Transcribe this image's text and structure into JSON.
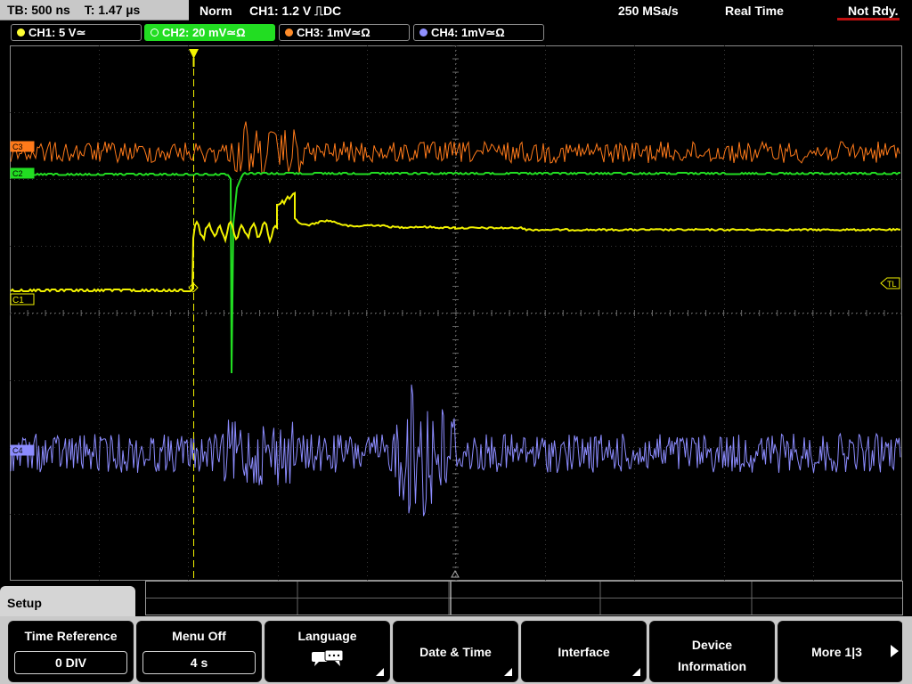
{
  "status": {
    "timebase": "TB: 500 ns",
    "trigger_time": "T: 1.47 µs",
    "mode": "Norm",
    "trigger_info": "CH1: 1.2 V ⎍DC",
    "sample_rate": "250 MSa/s",
    "acq_mode": "Real Time",
    "state": "Not Rdy."
  },
  "channels": [
    {
      "label": "CH1: 5 V≃",
      "color": "#ffff33"
    },
    {
      "label": "CH2: 20 mV≃Ω",
      "color": "#33ee33"
    },
    {
      "label": "CH3: 1mV≃Ω",
      "color": "#ff8c2a"
    },
    {
      "label": "CH4: 1mV≃Ω",
      "color": "#9090ff"
    }
  ],
  "markers": {
    "c1": "C1",
    "c2": "C2",
    "c3": "C3",
    "c4": "C4",
    "trigger_level": "TL"
  },
  "menu": {
    "title": "Setup",
    "softkeys": [
      {
        "label": "Time Reference",
        "value": "0 DIV"
      },
      {
        "label": "Menu Off",
        "value": "4 s"
      },
      {
        "label": "Language",
        "icon": "speech-bubbles-icon"
      },
      {
        "label": "Date & Time"
      },
      {
        "label": "Interface"
      },
      {
        "label_line1": "Device",
        "label_line2": "Information"
      },
      {
        "label": "More 1|3"
      }
    ]
  }
}
